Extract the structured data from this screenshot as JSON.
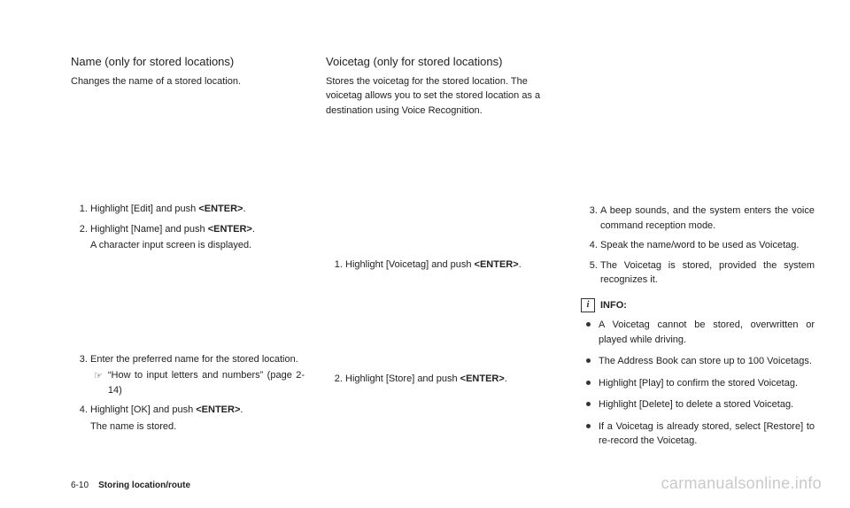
{
  "col1": {
    "title": "Name (only for stored locations)",
    "body": "Changes the name of a stored location.",
    "steps": {
      "s1a": "Highlight [Edit] and push ",
      "s1b": "<ENTER>",
      "s1c": ".",
      "s2a": "Highlight [Name] and push ",
      "s2b": "<ENTER>",
      "s2c": ".",
      "s2sub": "A character input screen is displayed.",
      "s3": "Enter the preferred name for the stored location.",
      "s3ref": "“How to input letters and numbers” (page 2-14)",
      "s4a": "Highlight [OK] and push ",
      "s4b": "<ENTER>",
      "s4c": ".",
      "s4sub": "The name is stored."
    }
  },
  "col2": {
    "title": "Voicetag (only for stored locations)",
    "body": "Stores the voicetag for the stored location. The voicetag allows you to set the stored location as a destination using Voice Recognition.",
    "steps": {
      "s1a": "Highlight [Voicetag] and push ",
      "s1b": "<ENTER>",
      "s1c": ".",
      "s2a": "Highlight [Store] and push ",
      "s2b": "<ENTER>",
      "s2c": "."
    }
  },
  "col3": {
    "steps": {
      "s3": "A beep sounds, and the system enters the voice command reception mode.",
      "s4": "Speak the name/word to be used as Voicetag.",
      "s5": "The Voicetag is stored, provided the system recognizes it."
    },
    "infoLabel": "INFO:",
    "bullets": {
      "b1": "A Voicetag cannot be stored, overwritten or played while driving.",
      "b2": "The Address Book can store up to 100 Voicetags.",
      "b3": "Highlight [Play] to confirm the stored Voicetag.",
      "b4": "Highlight [Delete] to delete a stored Voicetag.",
      "b5": "If a Voicetag is already stored, select [Restore] to re-record the Voicetag."
    }
  },
  "footer": {
    "pagenum": "6-10",
    "section": "Storing location/route"
  },
  "watermark": "carmanualsonline.info",
  "icons": {
    "ref": "☞"
  }
}
